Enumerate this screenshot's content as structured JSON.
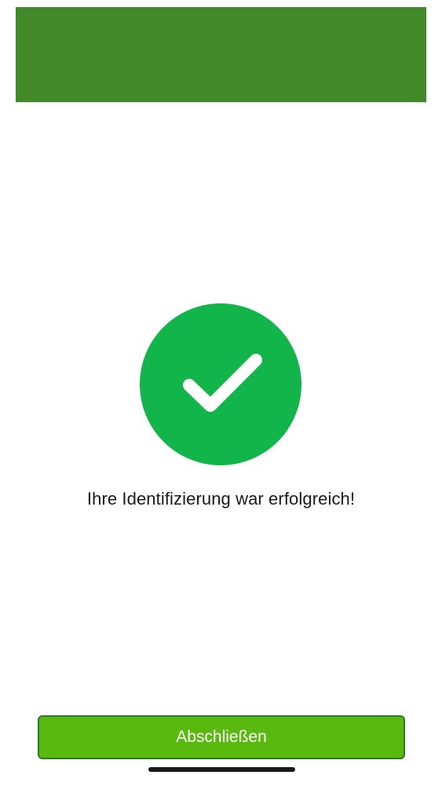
{
  "header": {
    "color": "#438a2b"
  },
  "status": {
    "icon": "checkmark-icon",
    "circle_color": "#11b54a",
    "message": "Ihre Identifizierung war erfolgreich!"
  },
  "actions": {
    "finish_label": "Abschließen",
    "button_color": "#5ab90e"
  }
}
